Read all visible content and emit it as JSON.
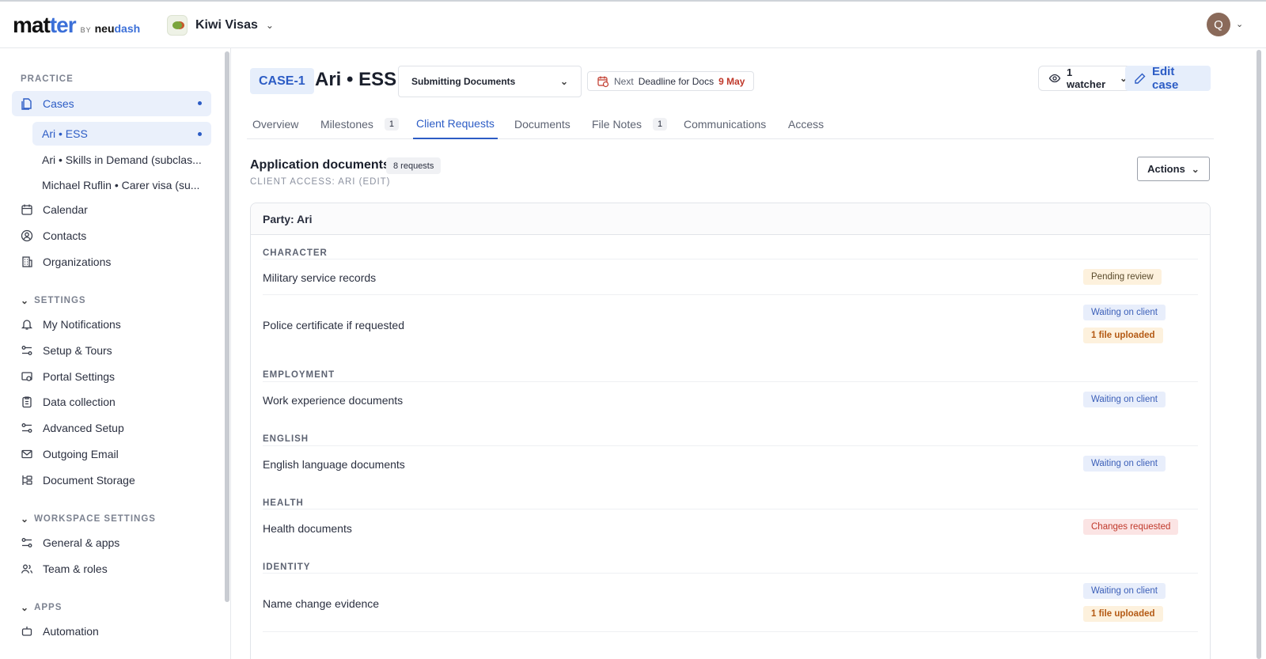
{
  "header": {
    "logo_main_a": "mat",
    "logo_main_b": "ter",
    "logo_by": "BY",
    "logo_neu": "neu",
    "logo_dash": "dash",
    "workspace": "Kiwi Visas",
    "avatar_initial": "Q"
  },
  "sidebar": {
    "practice_label": "PRACTICE",
    "cases": "Cases",
    "case_items": [
      "Ari • ESS",
      "Ari • Skills in Demand (subclas...",
      "Michael Ruflin • Carer visa (su..."
    ],
    "calendar": "Calendar",
    "contacts": "Contacts",
    "organizations": "Organizations",
    "settings_label": "SETTINGS",
    "settings_items": [
      "My Notifications",
      "Setup & Tours",
      "Portal Settings",
      "Data collection",
      "Advanced Setup",
      "Outgoing Email",
      "Document Storage"
    ],
    "workspace_label": "WORKSPACE SETTINGS",
    "workspace_items": [
      "General & apps",
      "Team & roles"
    ],
    "apps_label": "APPS",
    "apps_items": [
      "Automation"
    ]
  },
  "case": {
    "id": "CASE-1",
    "title": "Ari • ESS",
    "stage": "Submitting Documents",
    "deadline_next": "Next",
    "deadline_label": "Deadline for Docs",
    "deadline_date": "9 May",
    "watchers": "1 watcher",
    "edit_label": "Edit case"
  },
  "tabs": [
    {
      "label": "Overview",
      "badge": ""
    },
    {
      "label": "Milestones",
      "badge": "1"
    },
    {
      "label": "Client Requests",
      "badge": ""
    },
    {
      "label": "Documents",
      "badge": ""
    },
    {
      "label": "File Notes",
      "badge": "1"
    },
    {
      "label": "Communications",
      "badge": ""
    },
    {
      "label": "Access",
      "badge": ""
    }
  ],
  "requests": {
    "title": "Application documents",
    "count": "8 requests",
    "client_access": "CLIENT ACCESS: ARI (EDIT)",
    "actions_label": "Actions",
    "party": "Party: Ari",
    "categories": [
      "CHARACTER",
      "EMPLOYMENT",
      "ENGLISH",
      "HEALTH",
      "IDENTITY"
    ],
    "items": [
      {
        "label": "Military service records",
        "status": [
          "Pending review"
        ]
      },
      {
        "label": "Police certificate if requested",
        "status": [
          "Waiting on client",
          "1 file uploaded"
        ]
      },
      {
        "label": "Work experience documents",
        "status": [
          "Waiting on client"
        ]
      },
      {
        "label": "English language documents",
        "status": [
          "Waiting on client"
        ]
      },
      {
        "label": "Health documents",
        "status": [
          "Changes requested"
        ]
      },
      {
        "label": "Name change evidence",
        "status": [
          "Waiting on client",
          "1 file uploaded"
        ]
      }
    ]
  },
  "colors": {
    "accent": "#2c5cc5",
    "pending_bg": "#fdf1dd",
    "waiting_bg": "#e8eefb",
    "changes_bg": "#fbe4e4",
    "deadline_date": "#c0392b"
  },
  "icons": [
    "chevron-down-icon",
    "cases-icon",
    "calendar-icon",
    "contacts-icon",
    "organizations-icon",
    "bell-icon",
    "setup-icon",
    "portal-icon",
    "clipboard-icon",
    "sliders-icon",
    "mail-icon",
    "storage-icon",
    "team-icon",
    "automation-icon",
    "eye-icon",
    "pencil-icon",
    "calendar-clock-icon"
  ]
}
